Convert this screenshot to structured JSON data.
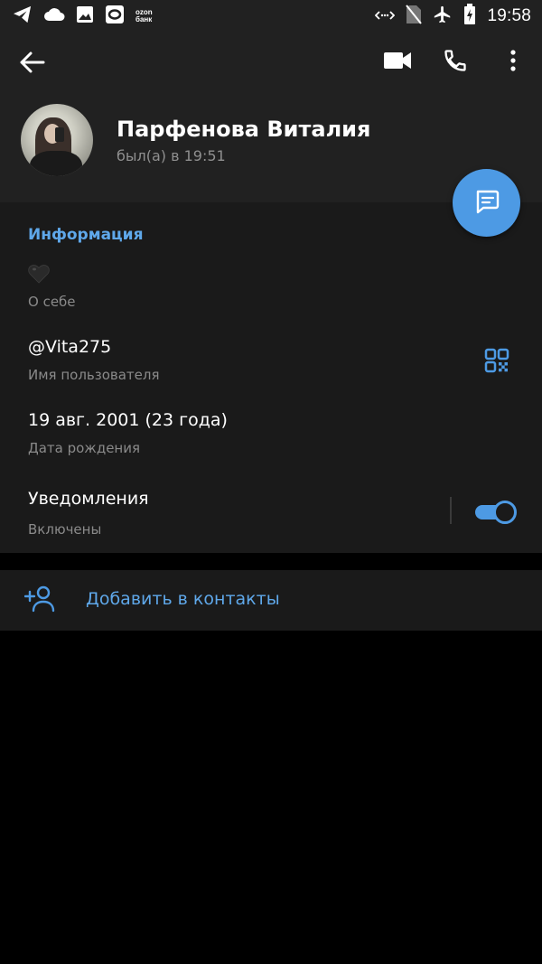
{
  "statusbar": {
    "time": "19:58",
    "ozon_line1": "ozon",
    "ozon_line2": "банк",
    "icons_left": [
      "telegram-icon",
      "cloud-icon",
      "image-icon",
      "ozon-app-icon"
    ],
    "icons_right": [
      "data-saver-icon",
      "no-sim-icon",
      "airplane-icon",
      "battery-charging-icon"
    ]
  },
  "header": {
    "icons": [
      "back-arrow-icon",
      "video-call-icon",
      "phone-call-icon",
      "more-vert-icon"
    ],
    "name": "Парфенова Виталия",
    "status": "был(а) в 19:51"
  },
  "fab": {
    "icon": "message-icon"
  },
  "info": {
    "title": "Информация",
    "bio_value": "🖤",
    "bio_label": "О себе",
    "username_value": "@Vita275",
    "username_label": "Имя пользователя",
    "birthday_value": "19 авг. 2001 (23 года)",
    "birthday_label": "Дата рождения",
    "notifications_value": "Уведомления",
    "notifications_label": "Включены",
    "notifications_on": true
  },
  "actions": {
    "add_contact_label": "Добавить в контакты",
    "add_contact_icon": "add-person-icon"
  },
  "colors": {
    "accent": "#4d9ae4",
    "header_bg": "#212121",
    "section_bg": "#1a1a1a",
    "page_bg": "#000000",
    "secondary_text": "#8a8a8a"
  }
}
